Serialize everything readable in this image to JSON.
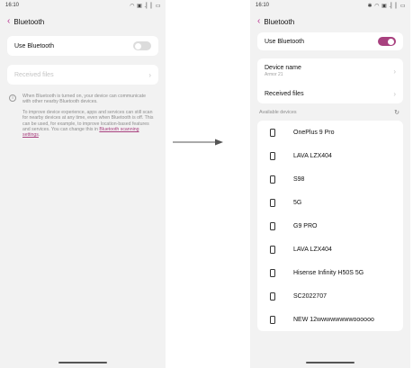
{
  "left": {
    "status": {
      "time": "16:10",
      "icons": "◠ ▣ .▏▏▭"
    },
    "title": "Bluetooth",
    "use_bluetooth": {
      "label": "Use Bluetooth",
      "state": "off"
    },
    "received_files": {
      "label": "Received files",
      "enabled": false
    },
    "info_icon": "i",
    "info_para1": "When Bluetooth is turned on, your device can communicate with other nearby Bluetooth devices.",
    "info_para2": "To improve device experience, apps and services can still scan for nearby devices at any time, even when Bluetooth is off. This can be used, for example, to improve location-based features and services. You can change this in",
    "info_link": "Bluetooth scanning settings",
    "info_end": "."
  },
  "right": {
    "status": {
      "time": "16:10",
      "icons": "✱ ◠ ▣ .▏▏▭"
    },
    "title": "Bluetooth",
    "use_bluetooth": {
      "label": "Use Bluetooth",
      "state": "on"
    },
    "device_name": {
      "label": "Device name",
      "value": "Armor 21"
    },
    "received_files": {
      "label": "Received files"
    },
    "available_label": "Available devices",
    "devices": [
      "OnePlus 9 Pro",
      "LAVA LZX404",
      "S98",
      "5G",
      "G9 PRO",
      "LAVA LZX404",
      "Hisense Infinity H50S 5G",
      "SC2022707",
      "NEW 12wwwwwwwwoooooo"
    ]
  },
  "colors": {
    "accent": "#a8417f",
    "toggle_off": "#dcdcdc",
    "background": "#f2f2f2"
  }
}
